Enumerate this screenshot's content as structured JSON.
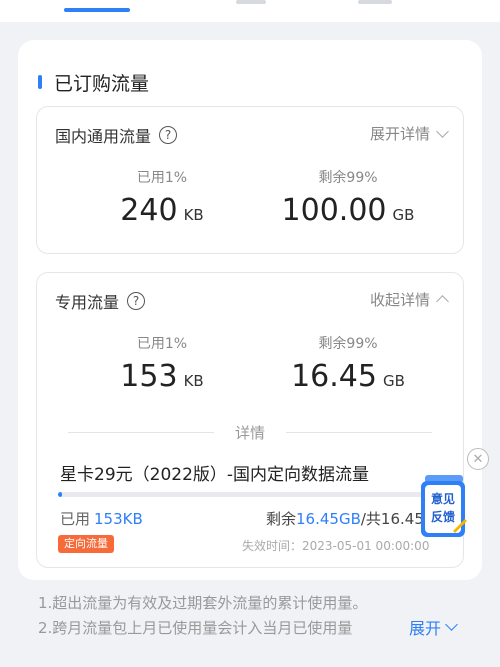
{
  "colors": {
    "accent": "#2f7ff7",
    "tag": "#f76b3a"
  },
  "purchased": {
    "title": "已订购流量",
    "general": {
      "label": "国内通用流量",
      "toggle_label": "展开详情",
      "used_label": "已用1%",
      "used_value": "240",
      "used_unit": "KB",
      "remain_label": "剩余99%",
      "remain_value": "100.00",
      "remain_unit": "GB"
    },
    "dedicated": {
      "label": "专用流量",
      "toggle_label": "收起详情",
      "used_label": "已用1%",
      "used_value": "153",
      "used_unit": "KB",
      "remain_label": "剩余99%",
      "remain_value": "16.45",
      "remain_unit": "GB",
      "detail_label": "详情",
      "package": {
        "name": "星卡29元（2022版）-国内定向数据流量",
        "progress": 0.01,
        "used_prefix": "已用",
        "used_amount": "153KB",
        "remain_prefix": "剩余",
        "remain_amount": "16.45GB",
        "total_text": "/共16.45GB",
        "tag": "定向流量",
        "expire": "失效时间：2023-05-01 00:00:00"
      }
    }
  },
  "notes": [
    "1.超出流量为有效及过期套外流量的累计使用量。",
    "2.跨月流量包上月已使用量会计入当月已使用量"
  ],
  "expand_label": "展开",
  "feedback": {
    "line1": "意见",
    "line2": "反馈"
  }
}
